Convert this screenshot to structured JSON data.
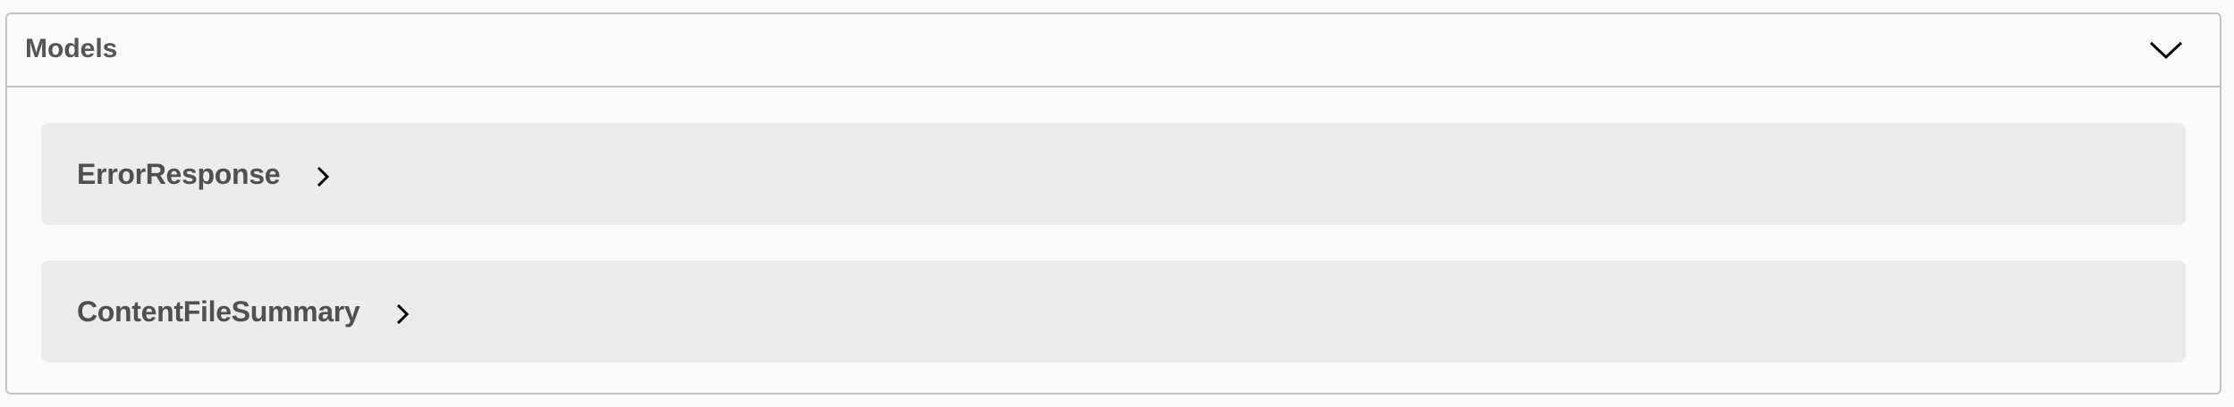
{
  "models": {
    "title": "Models",
    "toggle_icon": "chevron-down-icon",
    "items": [
      {
        "name": "ErrorResponse",
        "icon": "chevron-right-icon"
      },
      {
        "name": "ContentFileSummary",
        "icon": "chevron-right-icon"
      }
    ]
  },
  "colors": {
    "background": "#fafafa",
    "border": "#c4c4c4",
    "item_background": "#ececec",
    "title_text": "#555555"
  }
}
